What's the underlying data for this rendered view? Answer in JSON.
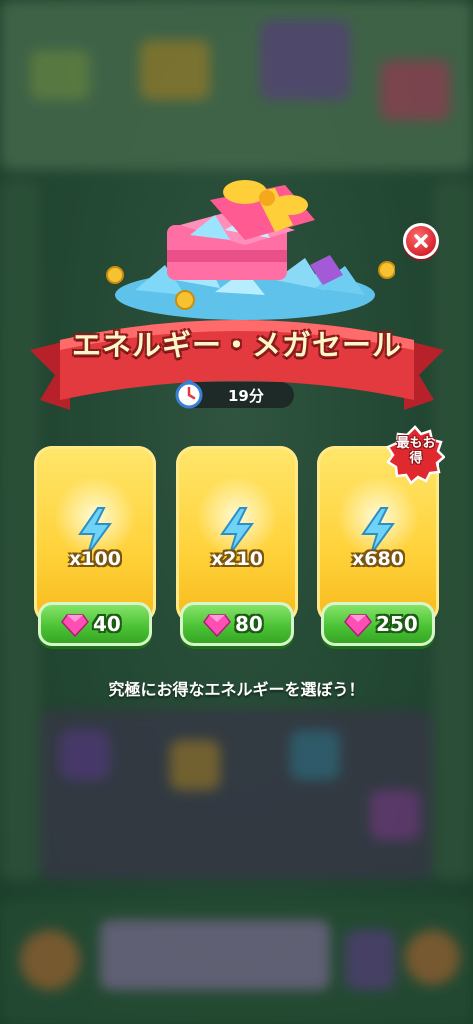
{
  "offer": {
    "title": "エネルギー・メガセール",
    "timer": "19分",
    "caption": "究極にお得なエネルギーを選ぼう！",
    "best_badge": "最もお得",
    "packs": [
      {
        "quantity": "x100",
        "price": "40"
      },
      {
        "quantity": "x210",
        "price": "80"
      },
      {
        "quantity": "x680",
        "price": "250"
      }
    ]
  },
  "icons": {
    "close": "close-icon",
    "timer": "stopwatch-icon",
    "energy": "lightning-bolt-icon",
    "currency": "pink-gem-icon"
  },
  "colors": {
    "ribbon": "#e23a3f",
    "card": "#ffd23a",
    "price_button": "#4cc436",
    "close_button": "#d6262f"
  }
}
